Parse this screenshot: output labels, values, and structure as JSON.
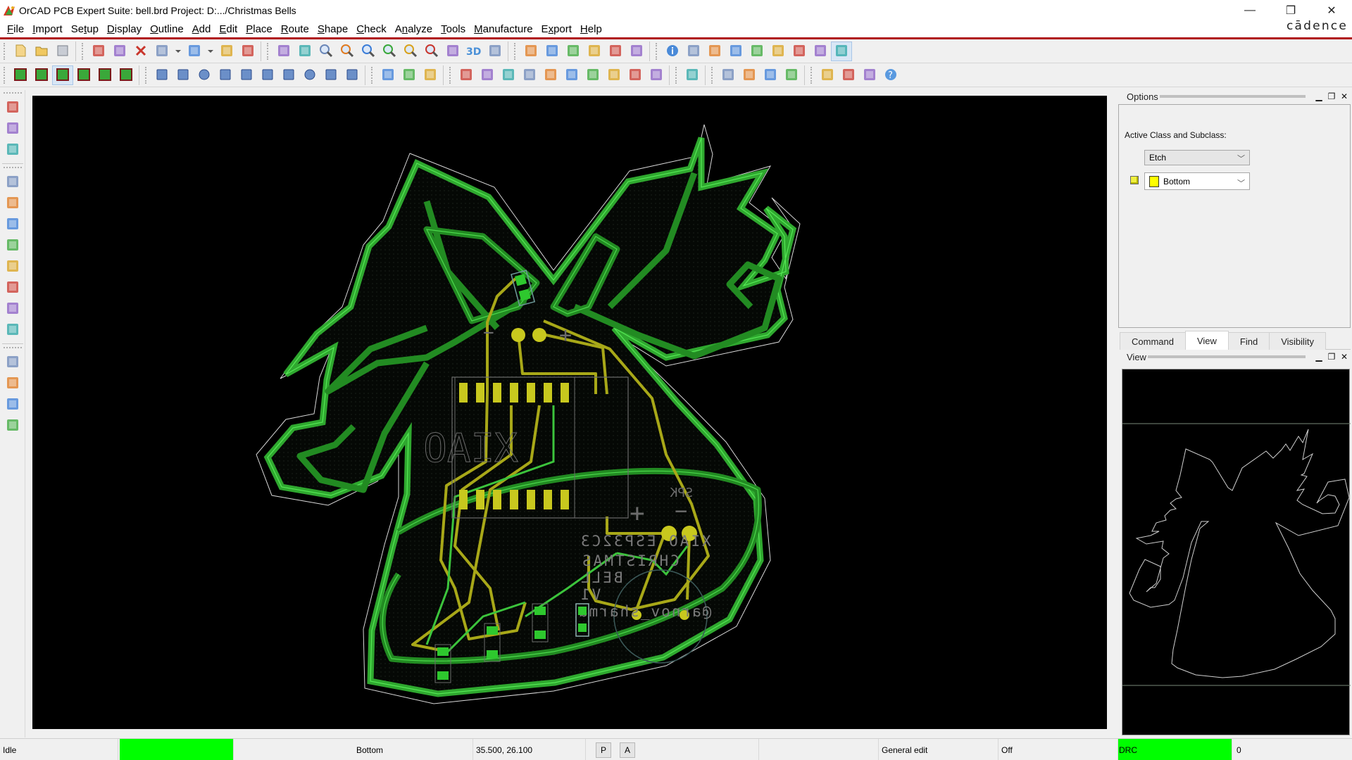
{
  "window": {
    "title": "OrCAD PCB Expert Suite: bell.brd  Project: D:.../Christmas Bells",
    "brand": "cādence",
    "controls": {
      "minimize": "—",
      "restore": "❐",
      "close": "✕"
    }
  },
  "menu": [
    {
      "label": "File",
      "ul": "F",
      "rest": "ile"
    },
    {
      "label": "Import",
      "ul": "I",
      "rest": "mport"
    },
    {
      "label": "Setup",
      "pre": "Se",
      "ul": "t",
      "rest": "up"
    },
    {
      "label": "Display",
      "ul": "D",
      "rest": "isplay"
    },
    {
      "label": "Outline",
      "ul": "O",
      "rest": "utline"
    },
    {
      "label": "Add",
      "ul": "A",
      "rest": "dd"
    },
    {
      "label": "Edit",
      "ul": "E",
      "rest": "dit"
    },
    {
      "label": "Place",
      "ul": "P",
      "rest": "lace"
    },
    {
      "label": "Route",
      "ul": "R",
      "rest": "oute"
    },
    {
      "label": "Shape",
      "ul": "S",
      "rest": "hape"
    },
    {
      "label": "Check",
      "ul": "C",
      "rest": "heck"
    },
    {
      "label": "Analyze",
      "pre": "A",
      "ul": "n",
      "rest": "alyze"
    },
    {
      "label": "Tools",
      "ul": "T",
      "rest": "ools"
    },
    {
      "label": "Manufacture",
      "ul": "M",
      "rest": "anufacture"
    },
    {
      "label": "Export",
      "pre": "E",
      "ul": "x",
      "rest": "port"
    },
    {
      "label": "Help",
      "ul": "H",
      "rest": "elp"
    }
  ],
  "toolbar1": {
    "groups": [
      [
        "new-file",
        "open-file",
        "save"
      ],
      [
        "move",
        "copy",
        "delete",
        "undo",
        "undo-dropdown",
        "redo",
        "redo-dropdown",
        "add-connect",
        "pin"
      ],
      [
        "grid-toggle",
        "unrats-all",
        "zoom-points",
        "zoom-fit",
        "zoom-in",
        "zoom-out",
        "zoom-world",
        "zoom-center",
        "refresh",
        "3d-view",
        "flip-design"
      ],
      [
        "grid",
        "color-dialog",
        "shadow-mode",
        "layer-visibility",
        "cm-manager",
        "global-view"
      ],
      [
        "info",
        "show-element",
        "measure",
        "highlight",
        "dehighlight",
        "assign-color",
        "padstack",
        "timing",
        "drc-select"
      ]
    ],
    "active": "drc-select"
  },
  "toolbar2": {
    "groups": [
      [
        "shape-fill-1",
        "shape-fill-2",
        "shape-fill-3",
        "shape-fill-4",
        "shape-fill-5",
        "shape-fill-6"
      ],
      [
        "shape-polygon",
        "shape-rect",
        "shape-circle",
        "shape-select",
        "shape-edit-boundary",
        "shape-void-poly",
        "shape-void-rect",
        "shape-void-circle",
        "shape-void-element",
        "shape-delete-islands"
      ],
      [
        "place-component",
        "dimension-linear",
        "dimension-datum"
      ],
      [
        "odb-export",
        "artwork",
        "nc-parameters",
        "snapshot",
        "renumber",
        "assembly-notes",
        "drill-legend",
        "testpoint",
        "variant",
        "multi-pad"
      ],
      [
        "route-net"
      ],
      [
        "report-1",
        "report-2",
        "report-3",
        "report-4"
      ],
      [
        "session-1",
        "session-2",
        "session-3",
        "help"
      ]
    ],
    "active": "shape-fill-3"
  },
  "left_toolbar": {
    "groups": [
      [
        "place-manual",
        "place-quickplace",
        "swap-components"
      ],
      [
        "add-connect",
        "slide",
        "delay-tune",
        "fanout",
        "route-bundle",
        "auto-interactive-route",
        "create-fanout",
        "phase-tune"
      ],
      [
        "add-line",
        "add-rect",
        "add-text",
        "edit-text"
      ]
    ]
  },
  "canvas": {
    "silkscreen_text": [
      "XIAO ESP32C3",
      "CHRISTMAS",
      "BELL",
      "V1",
      "@arnov_sharma"
    ],
    "speaker_label": "SPK",
    "speaker_plus": "+",
    "speaker_minus": "−",
    "battery_plus": "+",
    "battery_minus": "−",
    "module_logo": "XIAO",
    "layer_colors": {
      "etch_top": "#1f8a1f",
      "etch_edge": "#3fe23f",
      "etch_bottom": "#b5b51a",
      "pad": "#c8c81e",
      "outline": "#e0e0e0",
      "silk": "#8a8a8a"
    }
  },
  "options_panel": {
    "title": "Options",
    "label": "Active Class and Subclass:",
    "class_value": "Etch",
    "subclass_value": "Bottom",
    "subclass_color": "#ffff00"
  },
  "panel_tabs": [
    {
      "label": "Command",
      "active": false
    },
    {
      "label": "View",
      "active": true
    },
    {
      "label": "Find",
      "active": false
    },
    {
      "label": "Visibility",
      "active": false
    }
  ],
  "view_panel": {
    "title": "View"
  },
  "panel_buttons": {
    "minimize": "▁",
    "float": "🗗",
    "close": "✕"
  },
  "status": {
    "state": "Idle",
    "state_color": "#00ff00",
    "active_layer": "Bottom",
    "coordinates": "35.500, 26.100",
    "p_button": "P",
    "a_button": "A",
    "mode": "General edit",
    "snap": "Off",
    "drc_label": "DRC",
    "drc_color": "#00ff00",
    "drc_count": "0"
  }
}
